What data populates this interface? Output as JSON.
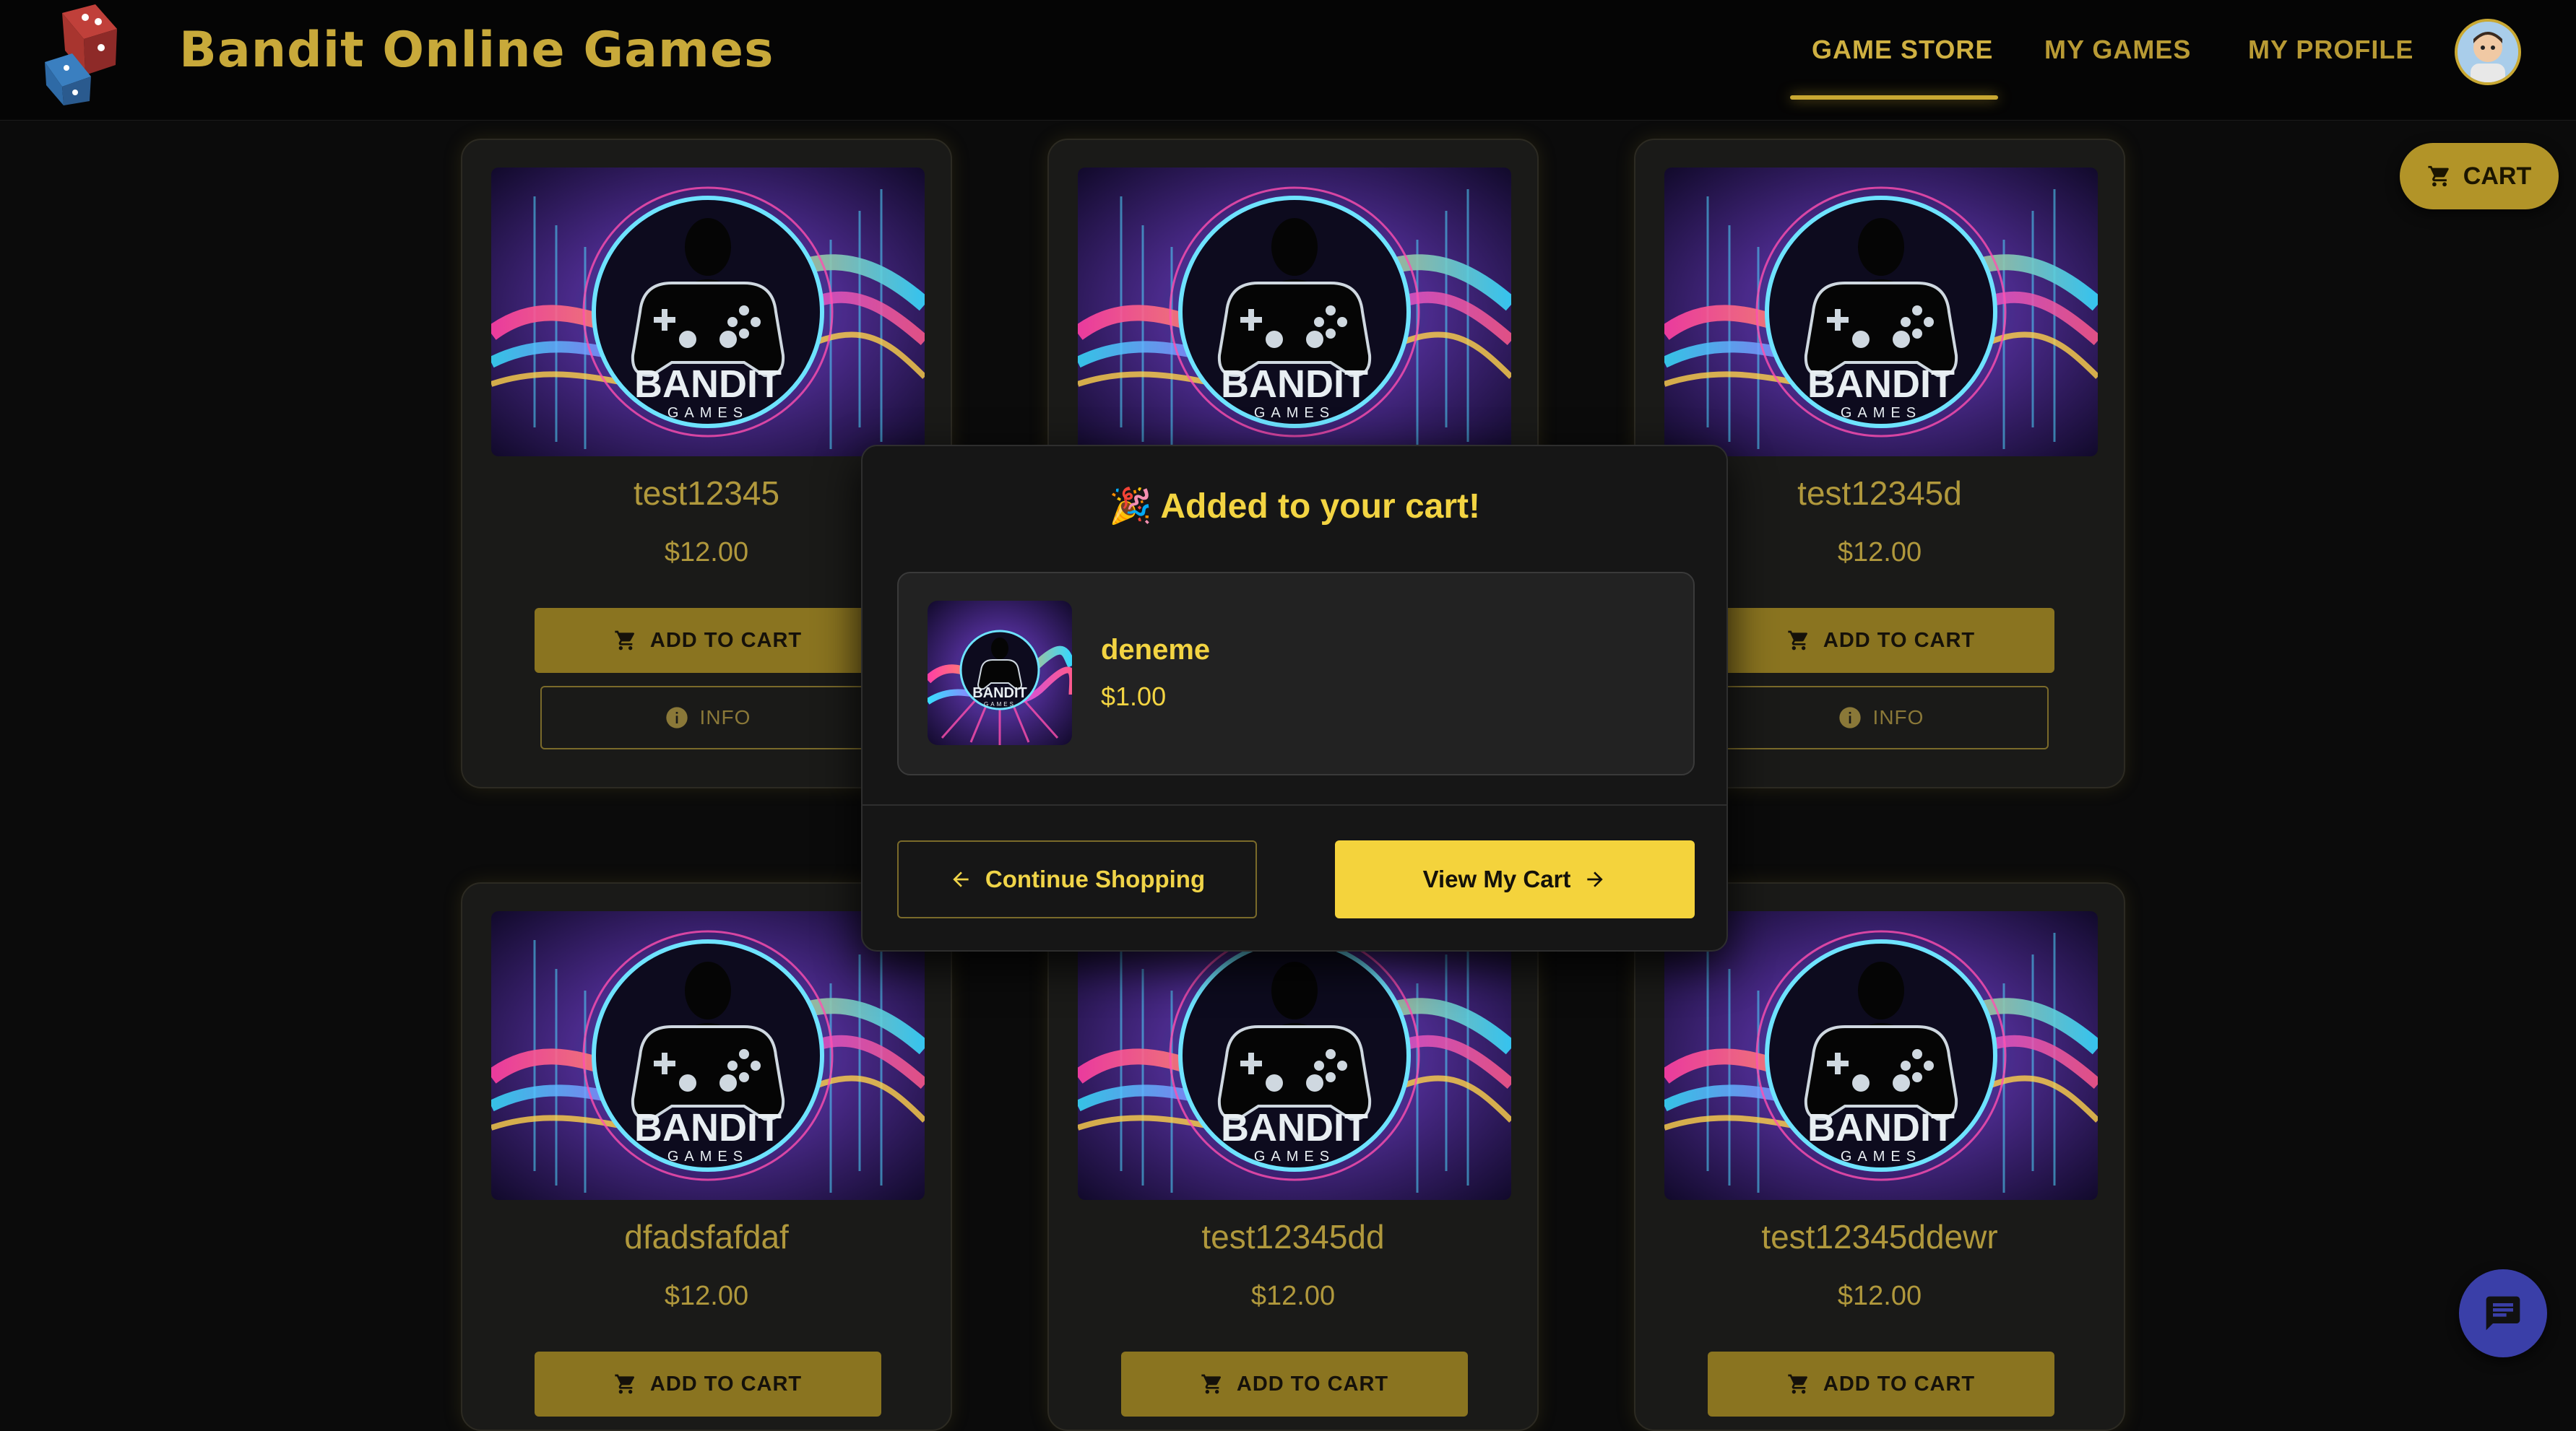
{
  "header": {
    "brand": "Bandit Online Games",
    "nav": [
      "GAME STORE",
      "MY GAMES",
      "MY PROFILE"
    ],
    "active_nav": "GAME STORE"
  },
  "cart_button": {
    "label": "CART"
  },
  "thumbnail_brand": {
    "name": "BANDIT",
    "sub": "GAMES"
  },
  "games": [
    {
      "title": "test12345",
      "price": "$12.00",
      "add_label": "ADD TO CART",
      "info_label": "INFO"
    },
    {
      "title": "",
      "price": "",
      "add_label": "",
      "info_label": ""
    },
    {
      "title": "test12345d",
      "price": "$12.00",
      "add_label": "ADD TO CART",
      "info_label": "INFO"
    },
    {
      "title": "dfadsfafdaf",
      "price": "$12.00",
      "add_label": "ADD TO CART",
      "info_label": ""
    },
    {
      "title": "test12345dd",
      "price": "$12.00",
      "add_label": "ADD TO CART",
      "info_label": ""
    },
    {
      "title": "test12345ddewr",
      "price": "$12.00",
      "add_label": "ADD TO CART",
      "info_label": ""
    }
  ],
  "modal": {
    "emoji": "🎉",
    "title": "Added to your cart!",
    "item": {
      "name": "deneme",
      "price": "$1.00"
    },
    "continue_label": "Continue Shopping",
    "view_label": "View My Cart"
  },
  "colors": {
    "accent": "#f4d33c",
    "muted_accent": "#b0983c",
    "background": "#0b0b0b",
    "chat_button": "#3a3fa8"
  }
}
